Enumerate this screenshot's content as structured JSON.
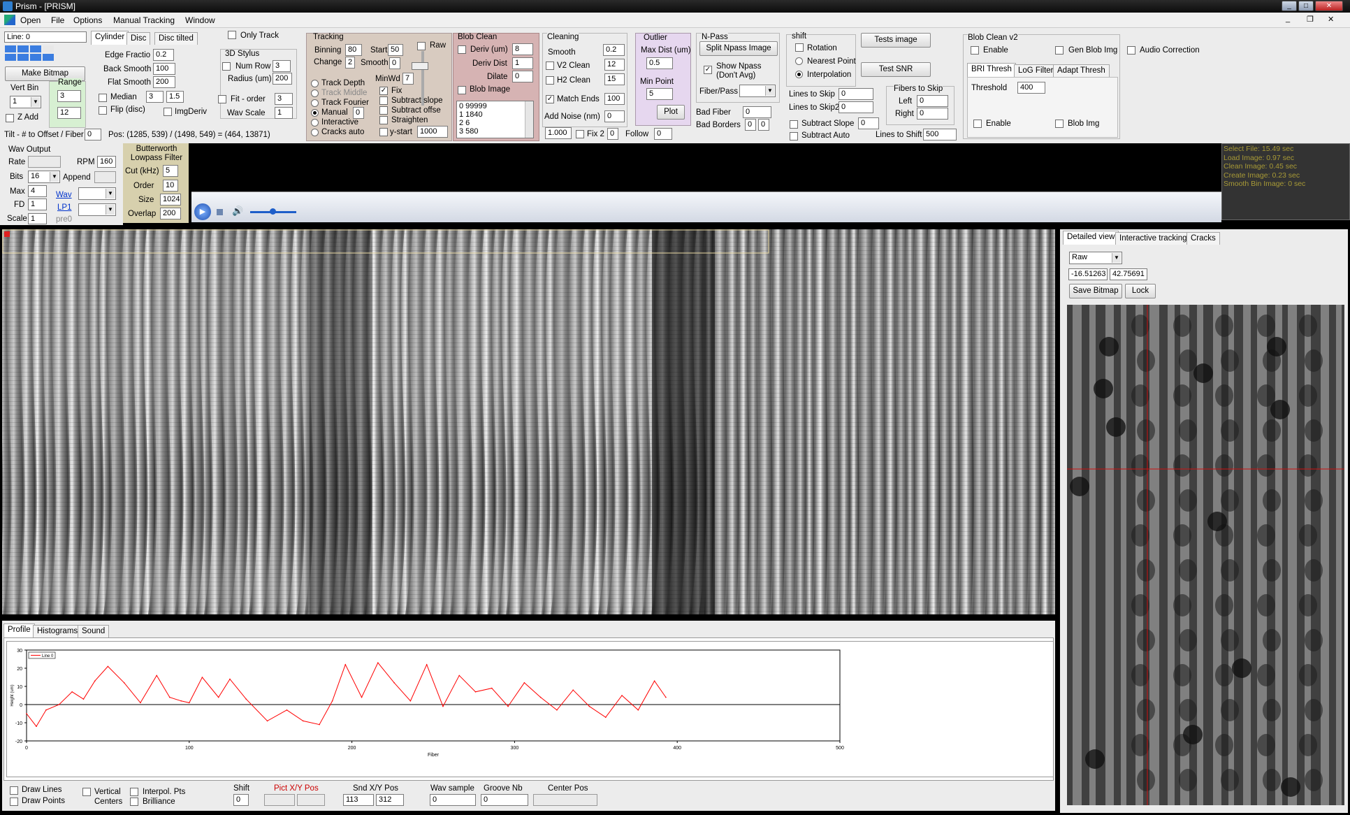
{
  "window": {
    "title": "Prism - [PRISM]"
  },
  "menu": [
    "Open",
    "File",
    "Options",
    "Manual Tracking",
    "Window"
  ],
  "left": {
    "line_label": "Line: 0",
    "make_bitmap": "Make Bitmap",
    "vert_bin_label": "Vert Bin",
    "vert_bin_value": "1",
    "range_label": "Range",
    "range_min": "3",
    "range_max": "12",
    "z_add": "Z Add",
    "tilt_label": "Tilt - # to Offset / Fiber",
    "tilt_value": "0",
    "pos_text": "Pos: (1285, 539) / (1498, 549) = (464, 13871)"
  },
  "cyl_tabs": [
    "Cylinder",
    "Disc",
    "Disc tilted"
  ],
  "cyl": {
    "edge_label": "Edge Fractio",
    "edge": "0.2",
    "back_label": "Back Smooth",
    "back": "100",
    "flat_label": "Flat Smooth",
    "flat": "200",
    "median_label": "Median",
    "median_a": "3",
    "median_b": "1.5",
    "flip_label": "Flip (disc)",
    "imgderiv_label": "ImgDeriv"
  },
  "stylus": {
    "only_track": "Only Track",
    "title": "3D Stylus",
    "numrow_label": "Num Row",
    "numrow": "3",
    "radius_label": "Radius (um)",
    "radius": "200",
    "fit_label": "Fit - order",
    "fit": "3",
    "wavscale_label": "Wav Scale",
    "wavscale": "1"
  },
  "tracking": {
    "title": "Tracking",
    "binning_label": "Binning",
    "binning": "80",
    "start_label": "Start",
    "start": "50",
    "raw_label": "Raw",
    "change_label": "Change",
    "change": "2",
    "smooth_label": "Smooth",
    "smooth": "0",
    "minwd_label": "MinWd",
    "minwd": "7",
    "modes": [
      "Track Depth",
      "Track Middle",
      "Track Fourier",
      "Manual",
      "Interactive",
      "Cracks auto"
    ],
    "manual_value": "0",
    "options": [
      "Fix",
      "Subtract slope",
      "Subtract offse",
      "Straighten",
      "y-start"
    ],
    "ystart": "1000"
  },
  "blob": {
    "title": "Blob Clean",
    "deriv_label": "Deriv (um)",
    "deriv": "8",
    "derivdist_label": "Deriv Dist",
    "derivdist": "1",
    "dilate_label": "Dilate",
    "dilate": "0",
    "blobimg_label": "Blob Image",
    "list": [
      "0 99999",
      "1 1840",
      "2 6",
      "3 580"
    ]
  },
  "cleaning": {
    "title": "Cleaning",
    "smooth_label": "Smooth",
    "smooth": "0.2",
    "v2_label": "V2 Clean",
    "v2": "12",
    "h2_label": "H2 Clean",
    "h2": "15",
    "match_label": "Match Ends",
    "match": "100",
    "addnoise_label": "Add Noise  (nm)",
    "addnoise": "0",
    "v1": "1.000",
    "fix2_label": "Fix 2",
    "fix2": "0",
    "follow_label": "Follow",
    "follow": "0"
  },
  "outlier": {
    "title": "Outlier",
    "maxdist_label": "Max Dist (um)",
    "maxdist": "0.5",
    "minpoint_label": "Min Point",
    "minpoint": "5",
    "plot": "Plot"
  },
  "npass": {
    "title": "N-Pass",
    "split": "Split Npass Image",
    "show": "Show Npass (Don't Avg)",
    "fiberpass": "Fiber/Pass",
    "badfiber_label": "Bad Fiber",
    "badfiber": "0",
    "badborders_label": "Bad Borders",
    "bb1": "0",
    "bb2": "0"
  },
  "shift": {
    "title": "shift",
    "rotation": "Rotation",
    "nearest": "Nearest Point",
    "interp": "Interpolation",
    "tests_image": "Tests image",
    "test_snr": "Test SNR",
    "skip_label": "Lines to Skip",
    "skip": "0",
    "skip2_label": "Lines to Skip2",
    "skip2": "0",
    "fibers_title": "Fibers to Skip",
    "left_label": "Left",
    "left": "0",
    "right_label": "Right",
    "right": "0",
    "subslope_label": "Subtract Slope",
    "subslope": "0",
    "subauto_label": "Subtract Auto",
    "shift_label": "Lines to Shift",
    "shift": "500"
  },
  "blobv2": {
    "title": "Blob Clean v2",
    "enable": "Enable",
    "gen": "Gen Blob Img",
    "tabs": [
      "BRI Thresh",
      "LoG Filter",
      "Adapt Thresh"
    ],
    "threshold_label": "Threshold",
    "threshold": "400",
    "enable2": "Enable",
    "blobimg": "Blob Img"
  },
  "audio_correction": "Audio Correction",
  "wav": {
    "title": "Wav Output",
    "rate_label": "Rate",
    "rpm_label": "RPM",
    "rpm": "160",
    "bits_label": "Bits",
    "bits": "16",
    "append_label": "Append",
    "max_label": "Max",
    "max": "4",
    "wav_link": "Wav",
    "fd_label": "FD",
    "fd": "1",
    "lp1_link": "LP1",
    "scale_label": "Scale",
    "scale": "1",
    "pre_label": "pre0"
  },
  "butter": {
    "title": "Butterworth Lowpass Filter",
    "cut_label": "Cut (kHz)",
    "cut": "5",
    "order_label": "Order",
    "order": "10",
    "size_label": "Size",
    "size": "1024",
    "overlap_label": "Overlap",
    "overlap": "200"
  },
  "timing": [
    "Select File: 15.49 sec",
    "Load Image: 0.97 sec",
    "Clean Image: 0.45 sec",
    "Create Image: 0.23 sec",
    "Smooth Bin Image: 0 sec"
  ],
  "bottom_tabs": [
    "Profile",
    "Histograms",
    "Sound"
  ],
  "right_tabs": [
    "Detailed view",
    "Interactive tracking",
    "Cracks"
  ],
  "right": {
    "mode": "Raw",
    "v1": "-16.51263",
    "v2": "42.75691",
    "save": "Save Bitmap",
    "lock": "Lock"
  },
  "footer": {
    "draw_lines": "Draw Lines",
    "draw_points": "Draw Points",
    "vertical": "Vertical",
    "centers": "Centers",
    "interpol": "Interpol. Pts",
    "brilliance": "Brilliance",
    "shift_label": "Shift",
    "shift": "0",
    "pict_label": "Pict X/Y Pos",
    "snd_label": "Snd X/Y Pos",
    "snd_x": "113",
    "snd_y": "312",
    "wav_label": "Wav sample",
    "wav": "0",
    "groove_label": "Groove Nb",
    "groove": "0",
    "center_label": "Center Pos"
  },
  "chart_data": {
    "type": "line",
    "series": [
      {
        "name": "Line 0",
        "x": [
          0,
          6,
          12,
          20,
          28,
          35,
          42,
          50,
          60,
          70,
          80,
          88,
          95,
          100,
          108,
          118,
          125,
          135,
          148,
          160,
          170,
          180,
          188,
          196,
          206,
          216,
          226,
          236,
          246,
          256,
          266,
          276,
          286,
          296,
          306,
          316,
          326,
          336,
          346,
          356,
          366,
          376,
          386,
          393
        ],
        "y": [
          -5,
          -12,
          -3,
          0,
          7,
          3,
          13,
          21,
          12,
          1,
          16,
          4,
          2,
          1,
          15,
          4,
          14,
          3,
          -9,
          -3,
          -9,
          -11,
          2,
          22,
          4,
          23,
          12,
          2,
          22,
          -1,
          16,
          7,
          9,
          -1,
          12,
          4,
          -3,
          8,
          -1,
          -7,
          5,
          -3,
          13,
          4
        ]
      }
    ],
    "xlim": [
      0,
      500
    ],
    "ylim": [
      -20,
      30
    ],
    "xticks": [
      0,
      100,
      200,
      300,
      400,
      500
    ],
    "yticks": [
      30,
      20,
      10,
      0,
      -10,
      -20
    ],
    "xlabel": "Fiber",
    "ylabel": "Height (um)",
    "legend": "Line 0"
  },
  "colors": {
    "accent": "#7a8cff",
    "tracking_bg": "#d8cbc0",
    "blob_bg": "#d6b3b3",
    "outlier_bg": "#e6d7ef",
    "butter_bg": "#d7d0ad",
    "timing_text": "#a89a36"
  }
}
